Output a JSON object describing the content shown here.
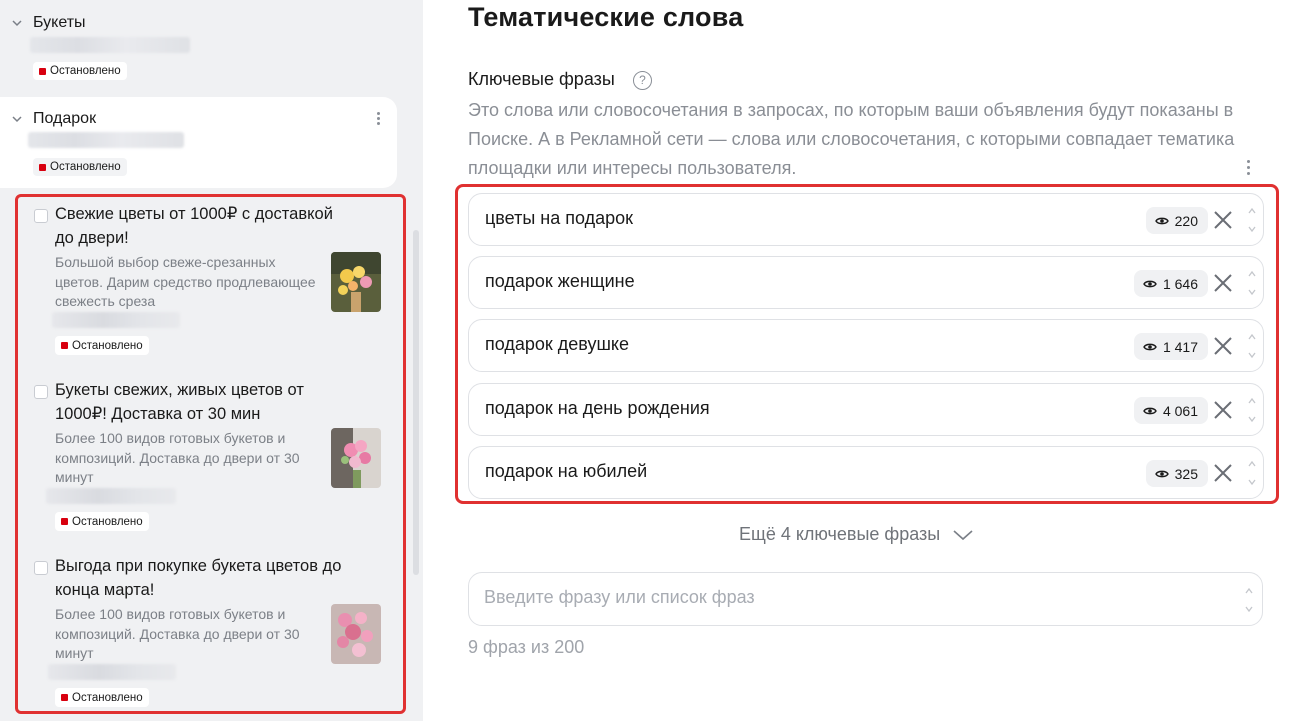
{
  "sidebar": {
    "groups": [
      {
        "title": "Букеты",
        "status": "Остановлено"
      },
      {
        "title": "Подарок",
        "status": "Остановлено"
      }
    ],
    "ads": [
      {
        "title": "Свежие цветы от 1000₽ с доставкой до двери!",
        "description": "Большой выбор свеже-срезанных цветов. Дарим средство продлевающее свежесть среза",
        "status": "Остановлено"
      },
      {
        "title": "Букеты свежих, живых цветов от 1000₽! Доставка от 30 мин",
        "description": "Более 100 видов готовых букетов и композиций. Доставка до двери от 30 минут",
        "status": "Остановлено"
      },
      {
        "title": "Выгода при покупке букета цветов до конца марта!",
        "description": "Более 100 видов готовых букетов и композиций. Доставка до двери от 30 минут",
        "status": "Остановлено"
      }
    ]
  },
  "main": {
    "title": "Тематические слова",
    "keywords_label": "Ключевые фразы",
    "help_icon": "question-circle-icon",
    "description": "Это слова или словосочетания в запросах, по которым ваши объявления будут показаны в Поиске. А в Рекламной сети — слова или словосочетания, с которыми совпадает тематика площадки или интересы пользователя.",
    "keywords": [
      {
        "phrase": "цветы на подарок",
        "views": "220"
      },
      {
        "phrase": "подарок женщине",
        "views": "1 646"
      },
      {
        "phrase": "подарок девушке",
        "views": "1 417"
      },
      {
        "phrase": "подарок на день рождения",
        "views": "4 061"
      },
      {
        "phrase": "подарок на юбилей",
        "views": "325"
      }
    ],
    "more_label": "Ещё 4 ключевые фразы",
    "input_placeholder": "Введите фразу или список фраз",
    "counter": "9 фраз из 200"
  },
  "colors": {
    "highlight_border": "#e03131",
    "status_red": "#d8000f",
    "sidebar_bg": "#f0f1f3",
    "muted_text": "#8a8e95"
  }
}
